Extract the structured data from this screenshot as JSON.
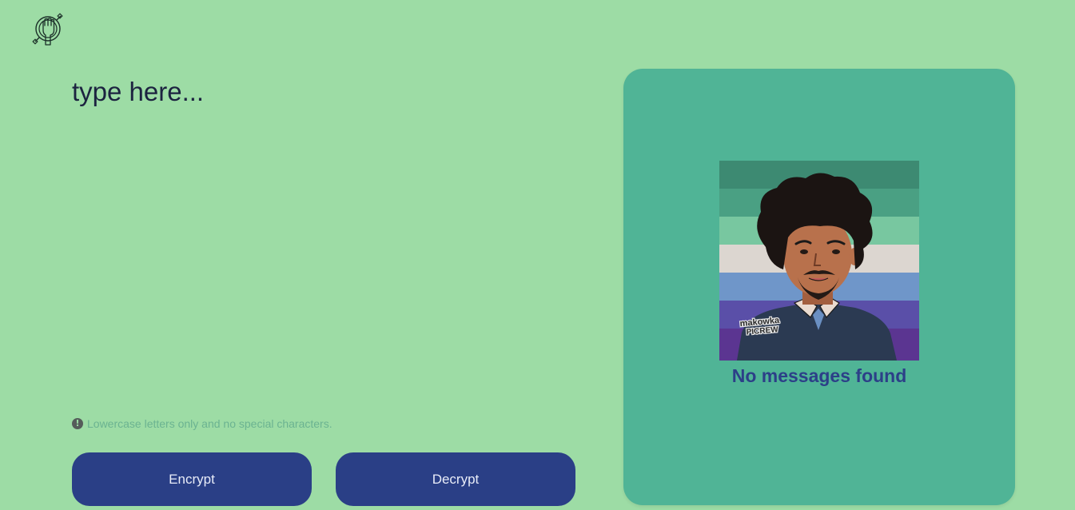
{
  "app": {
    "logo_icon": "raised-fist-venus-icon"
  },
  "editor": {
    "placeholder": "type here...",
    "value": ""
  },
  "hint": {
    "icon": "exclamation-circle-icon",
    "text": "Lowercase letters only and no special characters."
  },
  "actions": {
    "encrypt_label": "Encrypt",
    "decrypt_label": "Decrypt"
  },
  "messages": {
    "empty_text": "No messages found",
    "avatar_watermark_line1": "makowka",
    "avatar_watermark_line2": "PICREW"
  },
  "colors": {
    "background": "#9ddca5",
    "panel": "#50b496",
    "button": "#2a3f86",
    "text_dark": "#1c2340",
    "empty_text": "#2c3f88",
    "hint_text": "#6bb391",
    "flag_stripes": [
      "#3d8a72",
      "#4aa083",
      "#78c7a0",
      "#dcd6d0",
      "#6f96c9",
      "#5a4fa8",
      "#5b3591"
    ]
  }
}
